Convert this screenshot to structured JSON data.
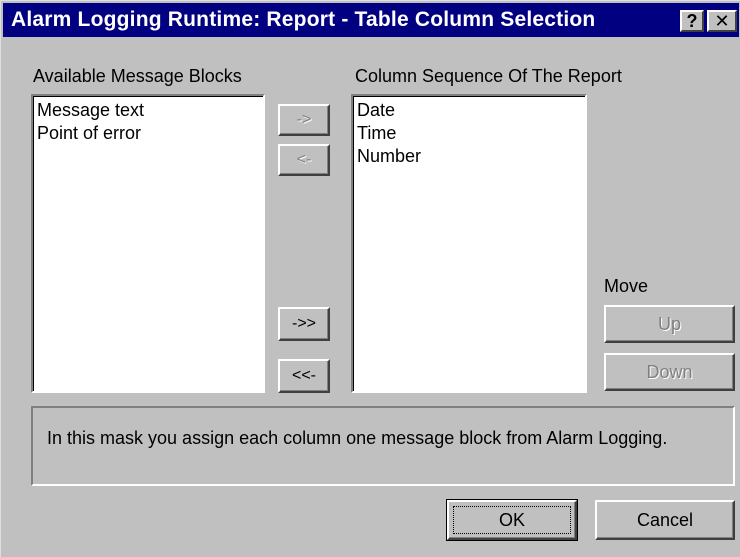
{
  "window": {
    "title": "Alarm Logging Runtime: Report - Table Column Selection",
    "help_button": "?",
    "close_button": "✕"
  },
  "available": {
    "label": "Available Message Blocks",
    "items": [
      "Message text",
      "Point of error"
    ]
  },
  "sequence": {
    "label": "Column Sequence Of The Report",
    "items": [
      "Date",
      "Time",
      "Number"
    ]
  },
  "transfer": {
    "add": "->",
    "remove": "<-",
    "add_all": "->>",
    "remove_all": "<<-"
  },
  "move": {
    "label": "Move",
    "up": "Up",
    "down": "Down"
  },
  "info": {
    "text": "In this mask you assign each column one message block from Alarm Logging."
  },
  "footer": {
    "ok": "OK",
    "cancel": "Cancel"
  }
}
